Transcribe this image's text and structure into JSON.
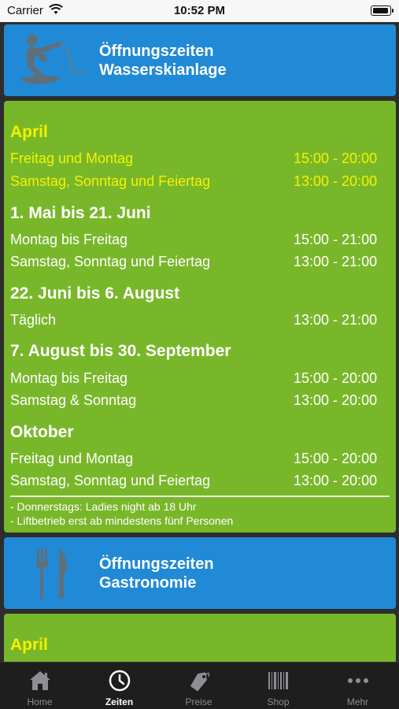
{
  "status_bar": {
    "carrier": "Carrier",
    "time": "10:52 PM"
  },
  "wasserski": {
    "icon": "wakeboarder-icon",
    "title_line1": "Öffnungszeiten",
    "title_line2": "Wasserskianlage",
    "sections": [
      {
        "title": "April",
        "rows": [
          {
            "label": "Freitag und Montag",
            "hours": "15:00 - 20:00"
          },
          {
            "label": "Samstag, Sonntag und Feiertag",
            "hours": "13:00 - 20:00"
          }
        ]
      },
      {
        "title": "1. Mai bis 21. Juni",
        "rows": [
          {
            "label": "Montag bis Freitag",
            "hours": "15:00 - 21:00"
          },
          {
            "label": "Samstag, Sonntag und Feiertag",
            "hours": "13:00 - 21:00"
          }
        ]
      },
      {
        "title": "22. Juni bis 6. August",
        "rows": [
          {
            "label": "Täglich",
            "hours": "13:00 - 21:00"
          }
        ]
      },
      {
        "title": "7. August bis 30. September",
        "rows": [
          {
            "label": "Montag bis Freitag",
            "hours": "15:00 - 20:00"
          },
          {
            "label": "Samstag & Sonntag",
            "hours": "13:00 - 20:00"
          }
        ]
      },
      {
        "title": "Oktober",
        "rows": [
          {
            "label": "Freitag und Montag",
            "hours": "15:00 - 20:00"
          },
          {
            "label": "Samstag, Sonntag und Feiertag",
            "hours": "13:00 - 20:00"
          }
        ]
      }
    ],
    "notes": [
      "- Donnerstags: Ladies night ab 18 Uhr",
      "- Liftbetrieb erst ab mindestens fünf Personen"
    ]
  },
  "gastro": {
    "icon": "fork-knife-icon",
    "title_line1": "Öffnungszeiten",
    "title_line2": "Gastronomie",
    "first_section_title": "April"
  },
  "tabbar": {
    "tabs": [
      {
        "label": "Home",
        "icon": "house-icon"
      },
      {
        "label": "Zeiten",
        "icon": "clock-icon",
        "active": true
      },
      {
        "label": "Preise",
        "icon": "price-tag-icon"
      },
      {
        "label": "Shop",
        "icon": "barcode-icon"
      },
      {
        "label": "Mehr",
        "icon": "more-dots-icon"
      }
    ]
  },
  "colors": {
    "highlight_yellow": "#f5f200",
    "panel_green": "#79b72a",
    "banner_blue": "#218ad6"
  }
}
